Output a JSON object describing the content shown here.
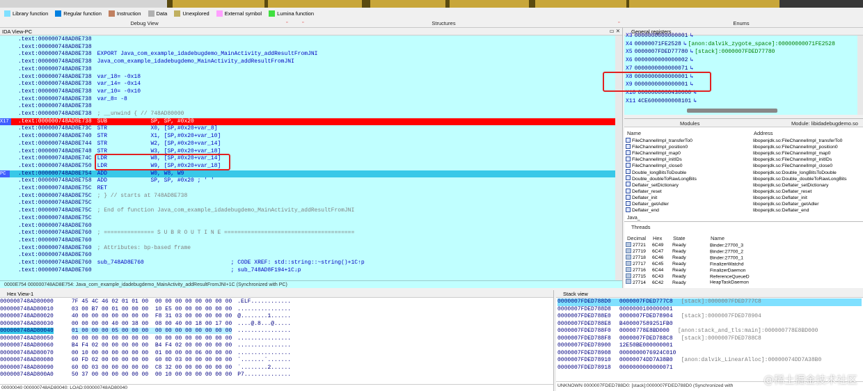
{
  "colors": {
    "bg": "#c0ffff",
    "highlight_red": "#ff0000",
    "highlight_pc": "#38c8e8",
    "accent": "#0000c0"
  },
  "legend": [
    {
      "label": "Library function",
      "color": "#80e0ff"
    },
    {
      "label": "Regular function",
      "color": "#0080e0"
    },
    {
      "label": "Instruction",
      "color": "#c08060"
    },
    {
      "label": "Data",
      "color": "#b0b0b0"
    },
    {
      "label": "Unexplored",
      "color": "#c0b060"
    },
    {
      "label": "External symbol",
      "color": "#ffa0ff"
    },
    {
      "label": "Lumina function",
      "color": "#40e040"
    }
  ],
  "tabs": {
    "debug_view": "Debug View",
    "structures": "Structures",
    "enums": "Enums"
  },
  "ida": {
    "title": "IDA View-PC",
    "gutter": {
      "x17": "X17",
      "pc": "PC"
    },
    "lines": [
      {
        "a": ".text:000000748AD8E738",
        "c": ""
      },
      {
        "a": ".text:000000748AD8E738",
        "c": ""
      },
      {
        "a": ".text:000000748AD8E738",
        "c": "EXPORT Java_com_example_idadebugdemo_MainActivity_addResultFromJNI"
      },
      {
        "a": ".text:000000748AD8E738",
        "c": "Java_com_example_idadebugdemo_MainActivity_addResultFromJNI"
      },
      {
        "a": ".text:000000748AD8E738",
        "c": ""
      },
      {
        "a": ".text:000000748AD8E738",
        "c": "var_18= -0x18"
      },
      {
        "a": ".text:000000748AD8E738",
        "c": "var_14= -0x14"
      },
      {
        "a": ".text:000000748AD8E738",
        "c": "var_10= -0x10"
      },
      {
        "a": ".text:000000748AD8E738",
        "c": "var_8= -8"
      },
      {
        "a": ".text:000000748AD8E738",
        "c": ""
      },
      {
        "a": ".text:000000748AD8E738",
        "c": "; __unwind { // 748AD80000"
      },
      {
        "a": ".text:000000748AD8E738",
        "c": "SUB             SP, SP, #0x20"
      },
      {
        "a": ".text:000000748AD8E73C",
        "c": "STR             X0, [SP,#0x20+var_8]"
      },
      {
        "a": ".text:000000748AD8E740",
        "c": "STR             X1, [SP,#0x20+var_10]"
      },
      {
        "a": ".text:000000748AD8E744",
        "c": "STR             W2, [SP,#0x20+var_14]"
      },
      {
        "a": ".text:000000748AD8E748",
        "c": "STR             W3, [SP,#0x20+var_18]"
      },
      {
        "a": ".text:000000748AD8E74C",
        "c": "LDR             W8, [SP,#0x20+var_14]"
      },
      {
        "a": ".text:000000748AD8E750",
        "c": "LDR             W9, [SP,#0x20+var_18]"
      },
      {
        "a": ".text:000000748AD8E754",
        "c": "ADD             W0, W8, W9"
      },
      {
        "a": ".text:000000748AD8E758",
        "c": "ADD             SP, SP, #0x20 ; ' '"
      },
      {
        "a": ".text:000000748AD8E75C",
        "c": "RET"
      },
      {
        "a": ".text:000000748AD8E75C",
        "c": "; } // starts at 748AD8E738"
      },
      {
        "a": ".text:000000748AD8E75C",
        "c": ""
      },
      {
        "a": ".text:000000748AD8E75C",
        "c": "; End of function Java_com_example_idadebugdemo_MainActivity_addResultFromJNI"
      },
      {
        "a": ".text:000000748AD8E75C",
        "c": ""
      },
      {
        "a": ".text:000000748AD8E760",
        "c": ""
      },
      {
        "a": ".text:000000748AD8E760",
        "c": "; =============== S U B R O U T I N E ======================================="
      },
      {
        "a": ".text:000000748AD8E760",
        "c": ""
      },
      {
        "a": ".text:000000748AD8E760",
        "c": "; Attributes: bp-based frame"
      },
      {
        "a": ".text:000000748AD8E760",
        "c": ""
      },
      {
        "a": ".text:000000748AD8E760",
        "c": "sub_748AD8E760                          ; CODE XREF: std::string::~string()+1C↑p"
      },
      {
        "a": ".text:000000748AD8E760",
        "c": "                                        ; sub_748AD8F194+1C↓p"
      }
    ],
    "status": "0000E754 000000748AD8E754: Java_com_example_idadebugdemo_MainActivity_addResultFromJNI+1C (Synchronized with PC)"
  },
  "registers": {
    "title": "General registers",
    "rows": [
      {
        "name": "X3",
        "value": "0000000000000001",
        "arrow": "↳",
        "note": ""
      },
      {
        "name": "X4",
        "value": "00000071FE2528",
        "arrow": "↳",
        "note": "[anon:dalvik_zygote_space]:00000000071FE2528"
      },
      {
        "name": "X5",
        "value": "0000007FDED77780",
        "arrow": "↳",
        "note": "[stack]:0000007FDED77780"
      },
      {
        "name": "X6",
        "value": "0000000000000002",
        "arrow": "↳",
        "note": ""
      },
      {
        "name": "X7",
        "value": "0000000000000071",
        "arrow": "↳",
        "note": ""
      },
      {
        "name": "X8",
        "value": "0000000000000001",
        "arrow": "↳",
        "note": ""
      },
      {
        "name": "X9",
        "value": "0000000000000001",
        "arrow": "↳",
        "note": ""
      },
      {
        "name": "X10",
        "value": "0000000000430000",
        "arrow": "↳",
        "note": ""
      },
      {
        "name": "X11",
        "value": "4CE6000000008101",
        "arrow": "↳",
        "note": ""
      }
    ]
  },
  "modules": {
    "tab_modules": "Modules",
    "tab_module": "Module: libidadebugdemo.so",
    "col_name": "Name",
    "col_address": "Address",
    "rows": [
      {
        "name": "FileChannelImpl_transferTo0",
        "addr": "libopenjdk.so:FileChannelImpl_transferTo0"
      },
      {
        "name": "FileChannelImpl_position0",
        "addr": "libopenjdk.so:FileChannelImpl_position0"
      },
      {
        "name": "FileChannelImpl_map0",
        "addr": "libopenjdk.so:FileChannelImpl_map0"
      },
      {
        "name": "FileChannelImpl_initIDs",
        "addr": "libopenjdk.so:FileChannelImpl_initIDs"
      },
      {
        "name": "FileChannelImpl_close0",
        "addr": "libopenjdk.so:FileChannelImpl_close0"
      },
      {
        "name": "Double_longBitsToDouble",
        "addr": "libopenjdk.so:Double_longBitsToDouble"
      },
      {
        "name": "Double_doubleToRawLongBits",
        "addr": "libopenjdk.so:Double_doubleToRawLongBits"
      },
      {
        "name": "Deflater_setDictionary",
        "addr": "libopenjdk.so:Deflater_setDictionary"
      },
      {
        "name": "Deflater_reset",
        "addr": "libopenjdk.so:Deflater_reset"
      },
      {
        "name": "Deflater_init",
        "addr": "libopenjdk.so:Deflater_init"
      },
      {
        "name": "Deflater_getAdler",
        "addr": "libopenjdk.so:Deflater_getAdler"
      },
      {
        "name": "Deflater_end",
        "addr": "libopenjdk.so:Deflater_end"
      }
    ],
    "filter": "Java_"
  },
  "threads": {
    "title": "Threads",
    "col_decimal": "Decimal",
    "col_hex": "Hex",
    "col_state": "State",
    "col_name": "Name",
    "rows": [
      {
        "dec": "27721",
        "hex": "6C49",
        "state": "Ready",
        "name": "Binder:27700_3"
      },
      {
        "dec": "27719",
        "hex": "6C47",
        "state": "Ready",
        "name": "Binder:27700_2"
      },
      {
        "dec": "27718",
        "hex": "6C46",
        "state": "Ready",
        "name": "Binder:27700_1"
      },
      {
        "dec": "27717",
        "hex": "6C45",
        "state": "Ready",
        "name": "FinalizerWatchd"
      },
      {
        "dec": "27716",
        "hex": "6C44",
        "state": "Ready",
        "name": "FinalizerDaemon"
      },
      {
        "dec": "27715",
        "hex": "6C43",
        "state": "Ready",
        "name": "ReferenceQueueD"
      },
      {
        "dec": "27714",
        "hex": "6C42",
        "state": "Ready",
        "name": "HeapTaskDaemon"
      }
    ]
  },
  "hex": {
    "title": "Hex View-1",
    "lines": [
      {
        "a": "000000748AD80000",
        "b": "7F 45 4C 46 02 01 01 00  00 00 00 00 00 00 00 00",
        "t": ".ELF............"
      },
      {
        "a": "000000748AD80010",
        "b": "03 00 B7 00 01 00 00 00  10 E5 00 00 00 00 00 00",
        "t": "................"
      },
      {
        "a": "000000748AD80020",
        "b": "40 00 00 00 00 00 00 00  F8 31 03 00 00 00 00 00",
        "t": "@........1......"
      },
      {
        "a": "000000748AD80030",
        "b": "00 00 00 00 40 00 38 00  08 00 40 00 18 00 17 00",
        "t": "....@.8...@....."
      },
      {
        "a": "000000748AD80040",
        "b": "01 00 00 00 05 00 00 00  00 00 00 00 00 00 00 00",
        "t": "................"
      },
      {
        "a": "000000748AD80050",
        "b": "00 00 00 00 00 00 00 00  00 00 00 00 00 00 00 00",
        "t": "................"
      },
      {
        "a": "000000748AD80060",
        "b": "B4 F4 02 00 00 00 00 00  B4 F4 02 00 00 00 00 00",
        "t": "................"
      },
      {
        "a": "000000748AD80070",
        "b": "00 10 00 00 00 00 00 00  01 00 00 00 06 00 00 00",
        "t": "................"
      },
      {
        "a": "000000748AD80080",
        "b": "60 FD 02 00 00 00 00 00  60 0D 03 00 00 00 00 00",
        "t": "`.......`......."
      },
      {
        "a": "000000748AD80090",
        "b": "60 0D 03 00 00 00 00 00  C8 32 00 00 00 00 00 00",
        "t": "`........2......"
      },
      {
        "a": "000000748AD800A0",
        "b": "50 37 00 00 00 00 00 00  00 10 00 00 00 00 00 00",
        "t": "P7.............."
      }
    ],
    "status": "00000040 000000748AD80040: LOAD:000000748AD80040"
  },
  "stack": {
    "title": "Stack view",
    "lines": [
      {
        "a": "0000007FDED788D0",
        "v": "0000007FDED777C8",
        "n": "[stack]:0000007FDED777C8"
      },
      {
        "a": "0000007FDED788D8",
        "v": "0000000100000001",
        "n": ""
      },
      {
        "a": "0000007FDED788E0",
        "v": "0000007FDED78904",
        "n": "[stack]:0000007FDED78904"
      },
      {
        "a": "0000007FDED788E8",
        "v": "B400007589251FB0",
        "n": ""
      },
      {
        "a": "0000007FDED788F0",
        "v": "00000778E8BD000",
        "n": "[anon:stack_and_tls:main]:000000778E8BD000"
      },
      {
        "a": "0000007FDED788F8",
        "v": "0000007FDED788C8",
        "n": "[stack]:0000007FDED788C8"
      },
      {
        "a": "0000007FDED78900",
        "v": "12E50BE000000001",
        "n": ""
      },
      {
        "a": "0000007FDED78908",
        "v": "0000000076924C010",
        "n": ""
      },
      {
        "a": "0000007FDED78910",
        "v": "00000074DD7A38B0",
        "n": "[anon:dalvik_LinearAlloc]:00000074DD7A38B0"
      },
      {
        "a": "0000007FDED78918",
        "v": "0000000000000071",
        "n": ""
      }
    ],
    "status": "UNKNOWN 0000007FDED788D0: [stack]:0000007FDED788D0 (Synchronized with"
  },
  "watermark": "@稀土掘金技术社区"
}
